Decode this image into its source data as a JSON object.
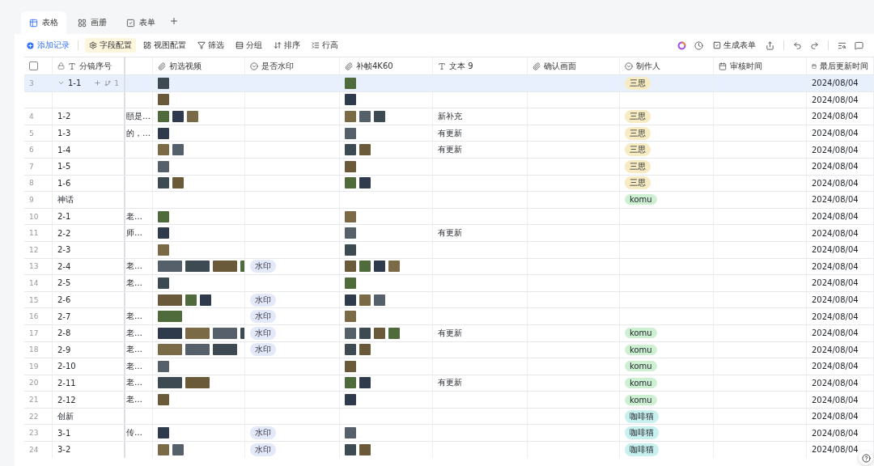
{
  "tabs": [
    {
      "label": "表格",
      "selected": true,
      "kind": "grid"
    },
    {
      "label": "画册",
      "selected": false,
      "kind": "gallery"
    },
    {
      "label": "表单",
      "selected": false,
      "kind": "form"
    }
  ],
  "toolbar": {
    "add_record": "添加记录",
    "actions": [
      {
        "label": "字段配置",
        "kind": "fields",
        "selected": true
      },
      {
        "label": "视图配置",
        "kind": "view",
        "selected": false
      },
      {
        "label": "筛选",
        "kind": "filter",
        "selected": false
      },
      {
        "label": "分组",
        "kind": "group",
        "selected": false
      },
      {
        "label": "排序",
        "kind": "sort",
        "selected": false
      },
      {
        "label": "行高",
        "kind": "height",
        "selected": false
      }
    ],
    "generate_form": "生成表单"
  },
  "table": {
    "select_all": {
      "checked": false
    },
    "columns": [
      {
        "label": "分镜序号",
        "kind": "text",
        "locked": true
      },
      {
        "label": "初选视频",
        "kind": "attachment"
      },
      {
        "label": "是否水印",
        "kind": "select"
      },
      {
        "label": "补帧4K60",
        "kind": "attachment"
      },
      {
        "label": "文本 9",
        "kind": "text"
      },
      {
        "label": "确认画面",
        "kind": "attachment"
      },
      {
        "label": "制作人",
        "kind": "select"
      },
      {
        "label": "审核时间",
        "kind": "date"
      },
      {
        "label": "最后更新时间",
        "kind": "date"
      }
    ],
    "rows": [
      {
        "num": "3",
        "seq": "1-1",
        "selected": true,
        "expanded": true,
        "sub_count": "1",
        "videos": [
          {
            "kind": "square"
          }
        ],
        "frames": [
          {
            "kind": "square"
          }
        ],
        "maker": {
          "label": "三思",
          "color": "#f6ebc2"
        },
        "updated": "2024/08/04"
      },
      {
        "selected": false,
        "videos": [
          {
            "kind": "square"
          }
        ],
        "frames": [
          {
            "kind": "square"
          }
        ],
        "updated": "2024/08/04"
      },
      {
        "num": "4",
        "seq": "1-2",
        "selected": false,
        "note": "頤是…",
        "videos": [
          {
            "kind": "square"
          },
          {
            "kind": "square"
          },
          {
            "kind": "square"
          }
        ],
        "frames": [
          {
            "kind": "square"
          },
          {
            "kind": "square"
          },
          {
            "kind": "square"
          }
        ],
        "text9": "新补充",
        "maker": {
          "label": "三思",
          "color": "#f6ebc2"
        },
        "updated": "2024/08/04"
      },
      {
        "num": "5",
        "seq": "1-3",
        "selected": false,
        "note": "的，…",
        "videos": [
          {
            "kind": "square"
          }
        ],
        "frames": [
          {
            "kind": "square"
          }
        ],
        "text9": "有更新",
        "maker": {
          "label": "三思",
          "color": "#f6ebc2"
        },
        "updated": "2024/08/04"
      },
      {
        "num": "6",
        "seq": "1-4",
        "selected": false,
        "videos": [
          {
            "kind": "square"
          },
          {
            "kind": "square"
          }
        ],
        "frames": [
          {
            "kind": "square"
          },
          {
            "kind": "square"
          }
        ],
        "text9": "有更新",
        "maker": {
          "label": "三思",
          "color": "#f6ebc2"
        },
        "updated": "2024/08/04"
      },
      {
        "num": "7",
        "seq": "1-5",
        "selected": false,
        "videos": [
          {
            "kind": "square"
          }
        ],
        "frames": [
          {
            "kind": "square"
          }
        ],
        "maker": {
          "label": "三思",
          "color": "#f6ebc2"
        },
        "updated": "2024/08/04"
      },
      {
        "num": "8",
        "seq": "1-6",
        "selected": false,
        "videos": [
          {
            "kind": "square"
          },
          {
            "kind": "square"
          }
        ],
        "frames": [
          {
            "kind": "square"
          },
          {
            "kind": "square"
          }
        ],
        "maker": {
          "label": "三思",
          "color": "#f6ebc2"
        },
        "updated": "2024/08/04"
      },
      {
        "num": "9",
        "seq": "神话",
        "selected": false,
        "maker": {
          "label": "komu",
          "color": "#cdf0d2"
        },
        "updated": "2024/08/04"
      },
      {
        "num": "10",
        "seq": "2-1",
        "selected": false,
        "note": "老…",
        "videos": [
          {
            "kind": "square"
          }
        ],
        "frames": [
          {
            "kind": "square"
          }
        ],
        "updated": "2024/08/04"
      },
      {
        "num": "11",
        "seq": "2-2",
        "selected": false,
        "note": "师…",
        "videos": [
          {
            "kind": "square"
          }
        ],
        "frames": [
          {
            "kind": "square"
          }
        ],
        "text9": "有更新",
        "updated": "2024/08/04"
      },
      {
        "num": "12",
        "seq": "2-3",
        "selected": false,
        "videos": [
          {
            "kind": "square"
          }
        ],
        "frames": [
          {
            "kind": "square"
          }
        ],
        "updated": "2024/08/04"
      },
      {
        "num": "13",
        "seq": "2-4",
        "selected": false,
        "note": "老…",
        "videos": [
          {
            "kind": "wide"
          },
          {
            "kind": "wide"
          },
          {
            "kind": "wide"
          },
          {
            "kind": "wide"
          }
        ],
        "watermark": "水印",
        "frames": [
          {
            "kind": "square"
          },
          {
            "kind": "square"
          },
          {
            "kind": "square"
          },
          {
            "kind": "square"
          }
        ],
        "updated": "2024/08/04"
      },
      {
        "num": "14",
        "seq": "2-5",
        "selected": false,
        "note": "老…",
        "videos": [
          {
            "kind": "square"
          }
        ],
        "frames": [
          {
            "kind": "square"
          }
        ],
        "updated": "2024/08/04"
      },
      {
        "num": "15",
        "seq": "2-6",
        "selected": false,
        "videos": [
          {
            "kind": "wide"
          },
          {
            "kind": "square"
          },
          {
            "kind": "square"
          }
        ],
        "watermark": "水印",
        "frames": [
          {
            "kind": "square"
          },
          {
            "kind": "square"
          },
          {
            "kind": "square"
          }
        ],
        "updated": "2024/08/04"
      },
      {
        "num": "16",
        "seq": "2-7",
        "selected": false,
        "note": "老…",
        "videos": [
          {
            "kind": "wide"
          }
        ],
        "watermark": "水印",
        "frames": [
          {
            "kind": "square"
          }
        ],
        "updated": "2024/08/04"
      },
      {
        "num": "17",
        "seq": "2-8",
        "selected": false,
        "note": "老…",
        "videos": [
          {
            "kind": "wide"
          },
          {
            "kind": "wide"
          },
          {
            "kind": "wide"
          },
          {
            "kind": "wide"
          }
        ],
        "watermark": "水印",
        "frames": [
          {
            "kind": "square"
          },
          {
            "kind": "square"
          },
          {
            "kind": "square"
          },
          {
            "kind": "square"
          }
        ],
        "text9": "有更新",
        "maker": {
          "label": "komu",
          "color": "#cdf0d2"
        },
        "updated": "2024/08/04"
      },
      {
        "num": "18",
        "seq": "2-9",
        "selected": false,
        "note": "老…",
        "videos": [
          {
            "kind": "wide"
          },
          {
            "kind": "wide"
          },
          {
            "kind": "wide"
          }
        ],
        "watermark": "水印",
        "frames": [
          {
            "kind": "square"
          },
          {
            "kind": "square"
          }
        ],
        "maker": {
          "label": "komu",
          "color": "#cdf0d2"
        },
        "updated": "2024/08/04"
      },
      {
        "num": "19",
        "seq": "2-10",
        "selected": false,
        "note": "老…",
        "videos": [
          {
            "kind": "square"
          }
        ],
        "frames": [
          {
            "kind": "square"
          }
        ],
        "maker": {
          "label": "komu",
          "color": "#cdf0d2"
        },
        "updated": "2024/08/04"
      },
      {
        "num": "20",
        "seq": "2-11",
        "selected": false,
        "note": "老…",
        "videos": [
          {
            "kind": "wide"
          },
          {
            "kind": "wide"
          }
        ],
        "frames": [
          {
            "kind": "square"
          },
          {
            "kind": "square"
          }
        ],
        "text9": "有更新",
        "maker": {
          "label": "komu",
          "color": "#cdf0d2"
        },
        "updated": "2024/08/04"
      },
      {
        "num": "21",
        "seq": "2-12",
        "selected": false,
        "note": "老…",
        "videos": [
          {
            "kind": "square"
          }
        ],
        "frames": [
          {
            "kind": "square"
          }
        ],
        "maker": {
          "label": "komu",
          "color": "#cdf0d2"
        },
        "updated": "2024/08/04"
      },
      {
        "num": "22",
        "seq": "创新",
        "selected": false,
        "maker": {
          "label": "咖啡猫",
          "color": "#c8f0ee"
        },
        "updated": "2024/08/04"
      },
      {
        "num": "23",
        "seq": "3-1",
        "selected": false,
        "note": "传…",
        "videos": [
          {
            "kind": "square"
          }
        ],
        "watermark": "水印",
        "frames": [
          {
            "kind": "square"
          }
        ],
        "maker": {
          "label": "咖啡猫",
          "color": "#c8f0ee"
        },
        "updated": "2024/08/04"
      },
      {
        "num": "24",
        "seq": "3-2",
        "selected": false,
        "videos": [
          {
            "kind": "square"
          },
          {
            "kind": "square"
          }
        ],
        "watermark": "水印",
        "frames": [
          {
            "kind": "square"
          },
          {
            "kind": "square"
          }
        ],
        "maker": {
          "label": "咖啡猫",
          "color": "#c8f0ee"
        },
        "updated": "2024/08/04"
      }
    ]
  }
}
